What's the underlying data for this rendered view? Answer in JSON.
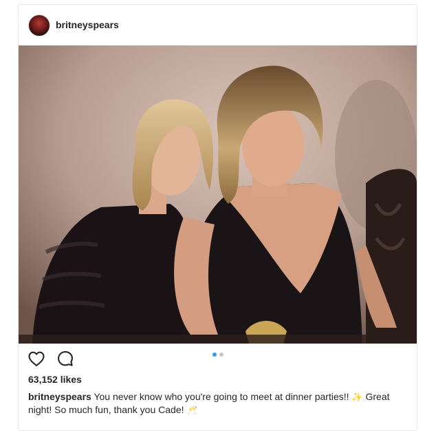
{
  "post": {
    "username": "britneyspears",
    "likes": "63,152 likes",
    "caption_user": "britneyspears",
    "caption_text_1": "You never know who you're going to meet at dinner parties!! ",
    "emoji_1": "✨",
    "caption_text_2": " Great night! So much fun, thank you Cade! ",
    "emoji_2": "🥂",
    "carousel": {
      "total": 2,
      "active": 1
    }
  },
  "icons": {
    "like": "heart-icon",
    "comment": "comment-icon"
  },
  "colors": {
    "accent": "#3897f0",
    "text": "#262626",
    "border": "#e6e6e6"
  }
}
